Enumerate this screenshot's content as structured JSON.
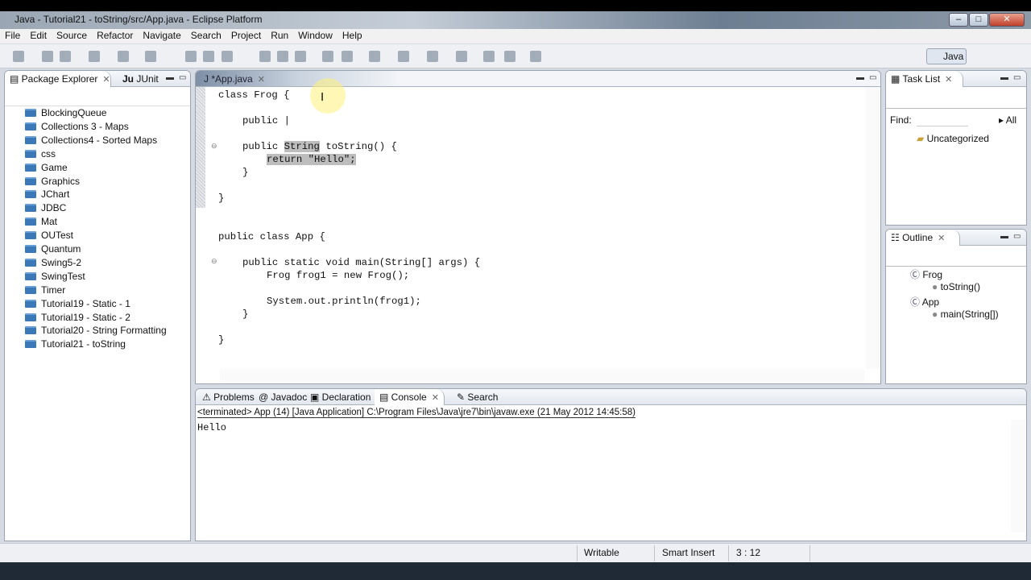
{
  "window": {
    "title": "Java - Tutorial21 - toString/src/App.java - Eclipse Platform",
    "minimize": "–",
    "maximize": "□",
    "close": "✕"
  },
  "menu": [
    "File",
    "Edit",
    "Source",
    "Refactor",
    "Navigate",
    "Search",
    "Project",
    "Run",
    "Window",
    "Help"
  ],
  "perspective": {
    "label": "Java"
  },
  "package_explorer": {
    "tab": "Package Explorer",
    "tab2": "JUnit",
    "tab2_prefix": "Ju",
    "items": [
      "BlockingQueue",
      "Collections 3 - Maps",
      "Collections4 - Sorted Maps",
      "css",
      "Game",
      "Graphics",
      "JChart",
      "JDBC",
      "Mat",
      "OUTest",
      "Quantum",
      "Swing5-2",
      "SwingTest",
      "Timer",
      "Tutorial19 - Static - 1",
      "Tutorial19 - Static - 2",
      "Tutorial20 - String Formatting",
      "Tutorial21 - toString"
    ]
  },
  "editor": {
    "tab": "*App.java",
    "lines": [
      {
        "indent": 0,
        "text": "class Frog {"
      },
      {
        "indent": 0,
        "text": ""
      },
      {
        "indent": 1,
        "text": "public |"
      },
      {
        "indent": 0,
        "text": ""
      },
      {
        "indent": 1,
        "pre": "public ",
        "hl": "String",
        "post": " toString() {"
      },
      {
        "indent": 2,
        "pre": "",
        "hl": "return \"Hello\";",
        "post": ""
      },
      {
        "indent": 1,
        "text": "}"
      },
      {
        "indent": 0,
        "text": ""
      },
      {
        "indent": 0,
        "text": "}"
      },
      {
        "indent": 0,
        "text": ""
      },
      {
        "indent": 0,
        "text": ""
      },
      {
        "indent": 0,
        "text": "public class App {"
      },
      {
        "indent": 0,
        "text": ""
      },
      {
        "indent": 1,
        "text": "public static void main(String[] args) {"
      },
      {
        "indent": 2,
        "text": "Frog frog1 = new Frog();"
      },
      {
        "indent": 0,
        "text": ""
      },
      {
        "indent": 2,
        "text": "System.out.println(frog1);"
      },
      {
        "indent": 1,
        "text": "}"
      },
      {
        "indent": 0,
        "text": ""
      },
      {
        "indent": 0,
        "text": "}"
      }
    ]
  },
  "task_list": {
    "tab": "Task List",
    "find_label": "Find:",
    "find_value": "",
    "all_label": "All",
    "category": "Uncategorized"
  },
  "outline": {
    "tab": "Outline",
    "items": [
      {
        "label": "Frog",
        "level": 0
      },
      {
        "label": "toString()",
        "level": 1
      },
      {
        "label": "App",
        "level": 0
      },
      {
        "label": "main(String[])",
        "level": 1
      }
    ]
  },
  "bottom": {
    "tabs": [
      "Problems",
      "Javadoc",
      "Declaration",
      "Console",
      "Search"
    ],
    "active": "Console",
    "console_header": "<terminated> App (14) [Java Application] C:\\Program Files\\Java\\jre7\\bin\\javaw.exe (21 May 2012 14:45:58)",
    "console_output": "Hello"
  },
  "status": {
    "writable": "Writable",
    "insert_mode": "Smart Insert",
    "position": "3 : 12"
  }
}
